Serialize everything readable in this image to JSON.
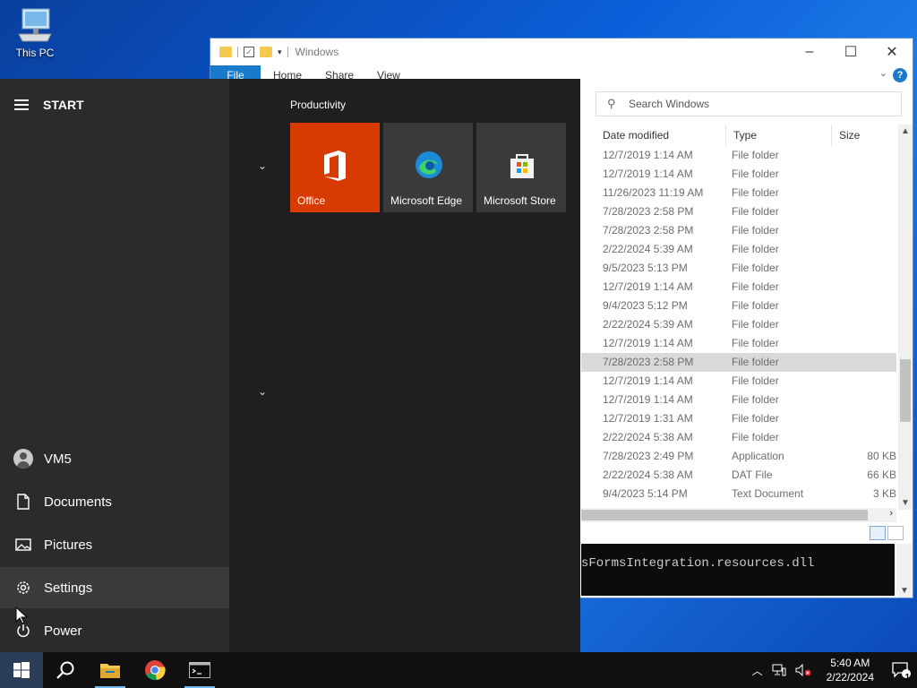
{
  "desktop": {
    "icons": [
      {
        "label": "This PC",
        "icon": "computer-icon"
      }
    ]
  },
  "explorer": {
    "title": "Windows",
    "ribbon_tabs": {
      "file": "File",
      "home": "Home",
      "share": "Share",
      "view": "View"
    },
    "search_placeholder": "Search Windows",
    "columns": {
      "date": "Date modified",
      "type": "Type",
      "size": "Size"
    },
    "rows": [
      {
        "date": "12/7/2019 1:14 AM",
        "type": "File folder",
        "size": ""
      },
      {
        "date": "12/7/2019 1:14 AM",
        "type": "File folder",
        "size": ""
      },
      {
        "date": "11/26/2023 11:19 AM",
        "type": "File folder",
        "size": ""
      },
      {
        "date": "7/28/2023 2:58 PM",
        "type": "File folder",
        "size": ""
      },
      {
        "date": "7/28/2023 2:58 PM",
        "type": "File folder",
        "size": ""
      },
      {
        "date": "2/22/2024 5:39 AM",
        "type": "File folder",
        "size": ""
      },
      {
        "date": "9/5/2023 5:13 PM",
        "type": "File folder",
        "size": ""
      },
      {
        "date": "12/7/2019 1:14 AM",
        "type": "File folder",
        "size": ""
      },
      {
        "date": "9/4/2023 5:12 PM",
        "type": "File folder",
        "size": ""
      },
      {
        "date": "2/22/2024 5:39 AM",
        "type": "File folder",
        "size": ""
      },
      {
        "date": "12/7/2019 1:14 AM",
        "type": "File folder",
        "size": ""
      },
      {
        "date": "7/28/2023 2:58 PM",
        "type": "File folder",
        "size": "",
        "selected": true
      },
      {
        "date": "12/7/2019 1:14 AM",
        "type": "File folder",
        "size": ""
      },
      {
        "date": "12/7/2019 1:14 AM",
        "type": "File folder",
        "size": ""
      },
      {
        "date": "12/7/2019 1:31 AM",
        "type": "File folder",
        "size": ""
      },
      {
        "date": "2/22/2024 5:38 AM",
        "type": "File folder",
        "size": ""
      },
      {
        "date": "7/28/2023 2:49 PM",
        "type": "Application",
        "size": "80 KB"
      },
      {
        "date": "2/22/2024 5:38 AM",
        "type": "DAT File",
        "size": "66 KB"
      },
      {
        "date": "9/4/2023 5:14 PM",
        "type": "Text Document",
        "size": "3 KB"
      }
    ]
  },
  "console": {
    "text": "sFormsIntegration.resources.dll"
  },
  "start_menu": {
    "header": "START",
    "side_items": [
      {
        "label": "VM5",
        "icon": "user-avatar-icon"
      },
      {
        "label": "Documents",
        "icon": "document-icon"
      },
      {
        "label": "Pictures",
        "icon": "pictures-icon"
      },
      {
        "label": "Settings",
        "icon": "gear-icon"
      },
      {
        "label": "Power",
        "icon": "power-icon"
      }
    ],
    "group_title": "Productivity",
    "tiles": [
      {
        "label": "Office",
        "color": "#d83b01",
        "icon": "office-icon"
      },
      {
        "label": "Microsoft Edge",
        "color": "#3a3a3a",
        "icon": "edge-icon"
      },
      {
        "label": "Microsoft Store",
        "color": "#3a3a3a",
        "icon": "store-icon"
      }
    ]
  },
  "taskbar": {
    "apps": [
      "search-icon",
      "file-explorer-icon",
      "chrome-icon",
      "terminal-icon"
    ],
    "time": "5:40 AM",
    "date": "2/22/2024",
    "notification_count": "1"
  }
}
